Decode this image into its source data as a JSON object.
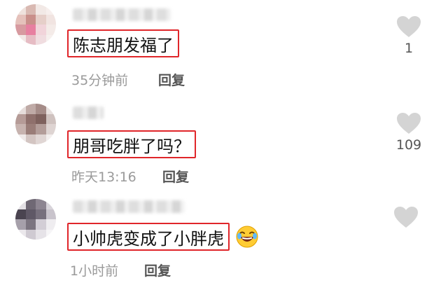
{
  "comments": [
    {
      "text": "陈志朋发福了",
      "time": "35分钟前",
      "reply_label": "回复",
      "likes": "1",
      "avatar_colors": [
        "#efe2dd",
        "#d9b9b2",
        "#f2e9e6",
        "#f7efed",
        "#e5c1bb",
        "#c98f8a",
        "#e6cfc9",
        "#f1e4e1",
        "#d79aa0",
        "#e77fa0",
        "#f1d4da",
        "#f4ebe8",
        "#f2e8e6",
        "#e6bcc4",
        "#f0dde0",
        "#f6f0ee"
      ]
    },
    {
      "text": "朋哥吃胖了吗？",
      "time": "昨天13:16",
      "reply_label": "回复",
      "likes": "109",
      "avatar_colors": [
        "#e6dddb",
        "#bfaaa6",
        "#a58c88",
        "#e8e1df",
        "#b59b97",
        "#8f706c",
        "#7e615d",
        "#cfc2bf",
        "#c7b3af",
        "#9a7d78",
        "#b39d99",
        "#ded4d2",
        "#efe9e8",
        "#d3c5c2",
        "#e0d6d4",
        "#f3efee"
      ]
    },
    {
      "text": "小帅虎变成了小胖虎",
      "time": "1小时前",
      "reply_label": "回复",
      "likes": "",
      "avatar_colors": [
        "#e4e1e5",
        "#6f6874",
        "#8d8591",
        "#d8d4da",
        "#4a4450",
        "#5f5866",
        "#77707d",
        "#c9c4cc",
        "#a6a0aa",
        "#7c7580",
        "#d3ced6",
        "#efedf0",
        "#ebe8ec",
        "#cfcad2",
        "#e6e3e8",
        "#f6f5f7"
      ]
    }
  ],
  "icons": {
    "like": "heart-icon",
    "emoji": "laughing-emoji-icon"
  },
  "colors": {
    "highlight_border": "#e0262a",
    "meta_text": "#9a9a9a",
    "heart": "#d4d4d4"
  }
}
